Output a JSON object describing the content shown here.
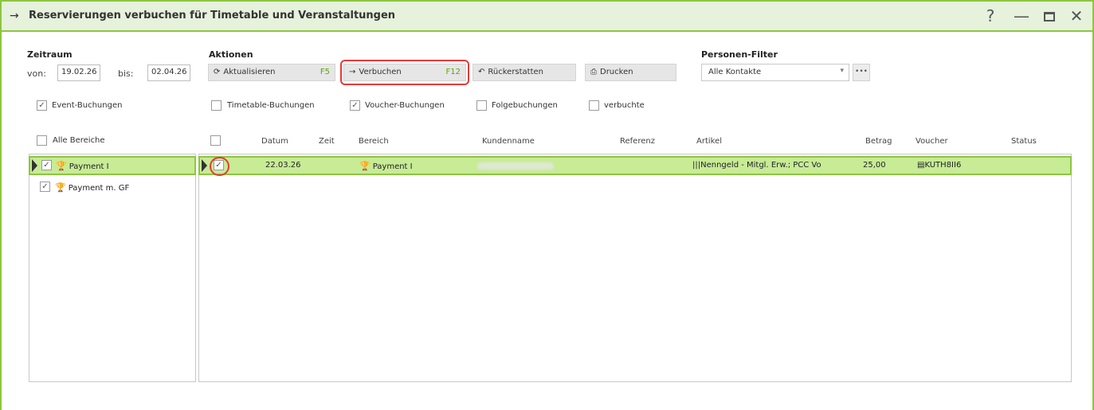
{
  "window": {
    "title_icon": "arrow-right-icon",
    "title": "Reservierungen verbuchen für Timetable und Veranstaltungen",
    "controls": {
      "help": "?",
      "minimize": "—",
      "close": "✕"
    }
  },
  "zeitraum": {
    "label": "Zeitraum",
    "von_label": "von:",
    "von_value": "19.02.26",
    "bis_label": "bis:",
    "bis_value": "02.04.26"
  },
  "aktionen": {
    "label": "Aktionen",
    "buttons": [
      {
        "label": "Aktualisieren",
        "key": "F5",
        "icon": "refresh-icon"
      },
      {
        "label": "Verbuchen",
        "key": "F12",
        "icon": "arrow-right-icon",
        "highlighted": true
      },
      {
        "label": "Rückerstatten",
        "key": "",
        "icon": "undo-icon"
      },
      {
        "label": "Drucken",
        "key": "",
        "icon": "printer-icon"
      }
    ]
  },
  "personen_filter": {
    "label": "Personen-Filter",
    "selected": "Alle Kontakte",
    "more": "•••"
  },
  "filters": [
    {
      "label": "Event-Buchungen",
      "checked": true
    },
    {
      "label": "Timetable-Buchungen",
      "checked": false
    },
    {
      "label": "Voucher-Buchungen",
      "checked": true
    },
    {
      "label": "Folgebuchungen",
      "checked": false
    },
    {
      "label": "verbuchte",
      "checked": false
    }
  ],
  "bereiche": {
    "header": "Alle Bereiche",
    "items": [
      {
        "label": "Payment I",
        "checked": true,
        "selected": true
      },
      {
        "label": "Payment m. GF",
        "checked": true,
        "selected": false
      }
    ]
  },
  "table": {
    "columns": [
      "Datum",
      "Zeit",
      "Bereich",
      "Kundenname",
      "Referenz",
      "Artikel",
      "Betrag",
      "Voucher",
      "Status"
    ],
    "rows": [
      {
        "checked": true,
        "datum": "22.03.26",
        "zeit": "",
        "bereich": "Payment I",
        "kundenname": "",
        "referenz": "",
        "artikel": "Nenngeld - Mitgl. Erw.; PCC Vo",
        "betrag": "25,00",
        "voucher": "KUTH8II6",
        "status": ""
      }
    ]
  },
  "colors": {
    "accent": "#8cc63f",
    "titlebar_bg": "#e6f2dc",
    "selected_row": "#c8eb96",
    "highlight": "#e53a3a",
    "hotkey": "#5aa800"
  }
}
